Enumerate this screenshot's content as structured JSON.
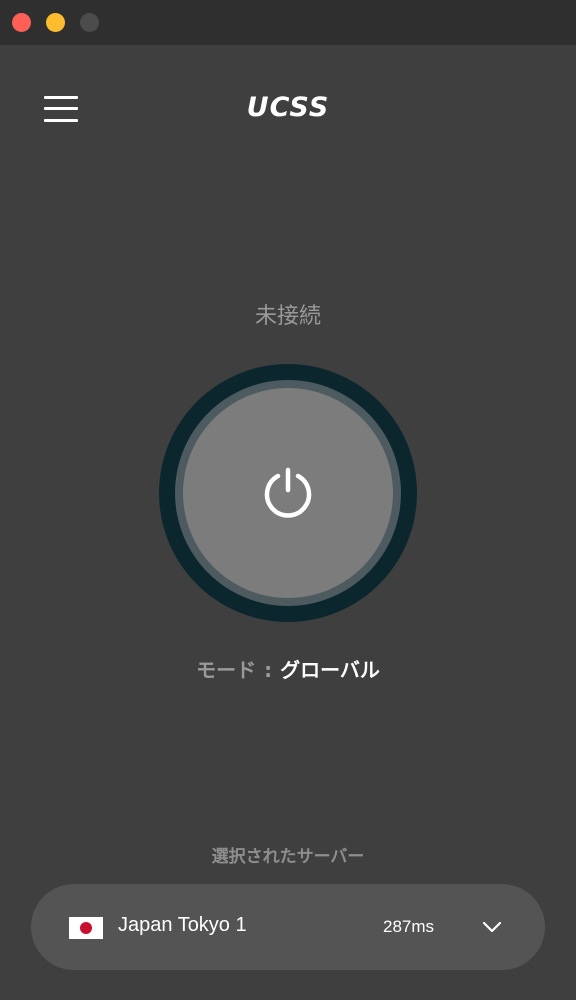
{
  "window": {
    "controls": [
      "close",
      "minimize",
      "maximize"
    ]
  },
  "header": {
    "menu_icon": "hamburger-menu-icon",
    "logo_text": "UCSS"
  },
  "connection": {
    "status": "未接続",
    "power_icon": "power-icon",
    "mode_label": "モード",
    "mode_separator": ":",
    "mode_value": "グローバル"
  },
  "server": {
    "section_label": "選択されたサーバー",
    "flag_icon": "japan-flag-icon",
    "name": "Japan Tokyo 1",
    "latency": "287ms",
    "dropdown_icon": "chevron-down-icon"
  },
  "colors": {
    "background": "#3f3f3f",
    "titlebar": "#2f2f2f",
    "ring": "#0c262d",
    "button": "#7c7c7c",
    "pill": "#545454"
  }
}
